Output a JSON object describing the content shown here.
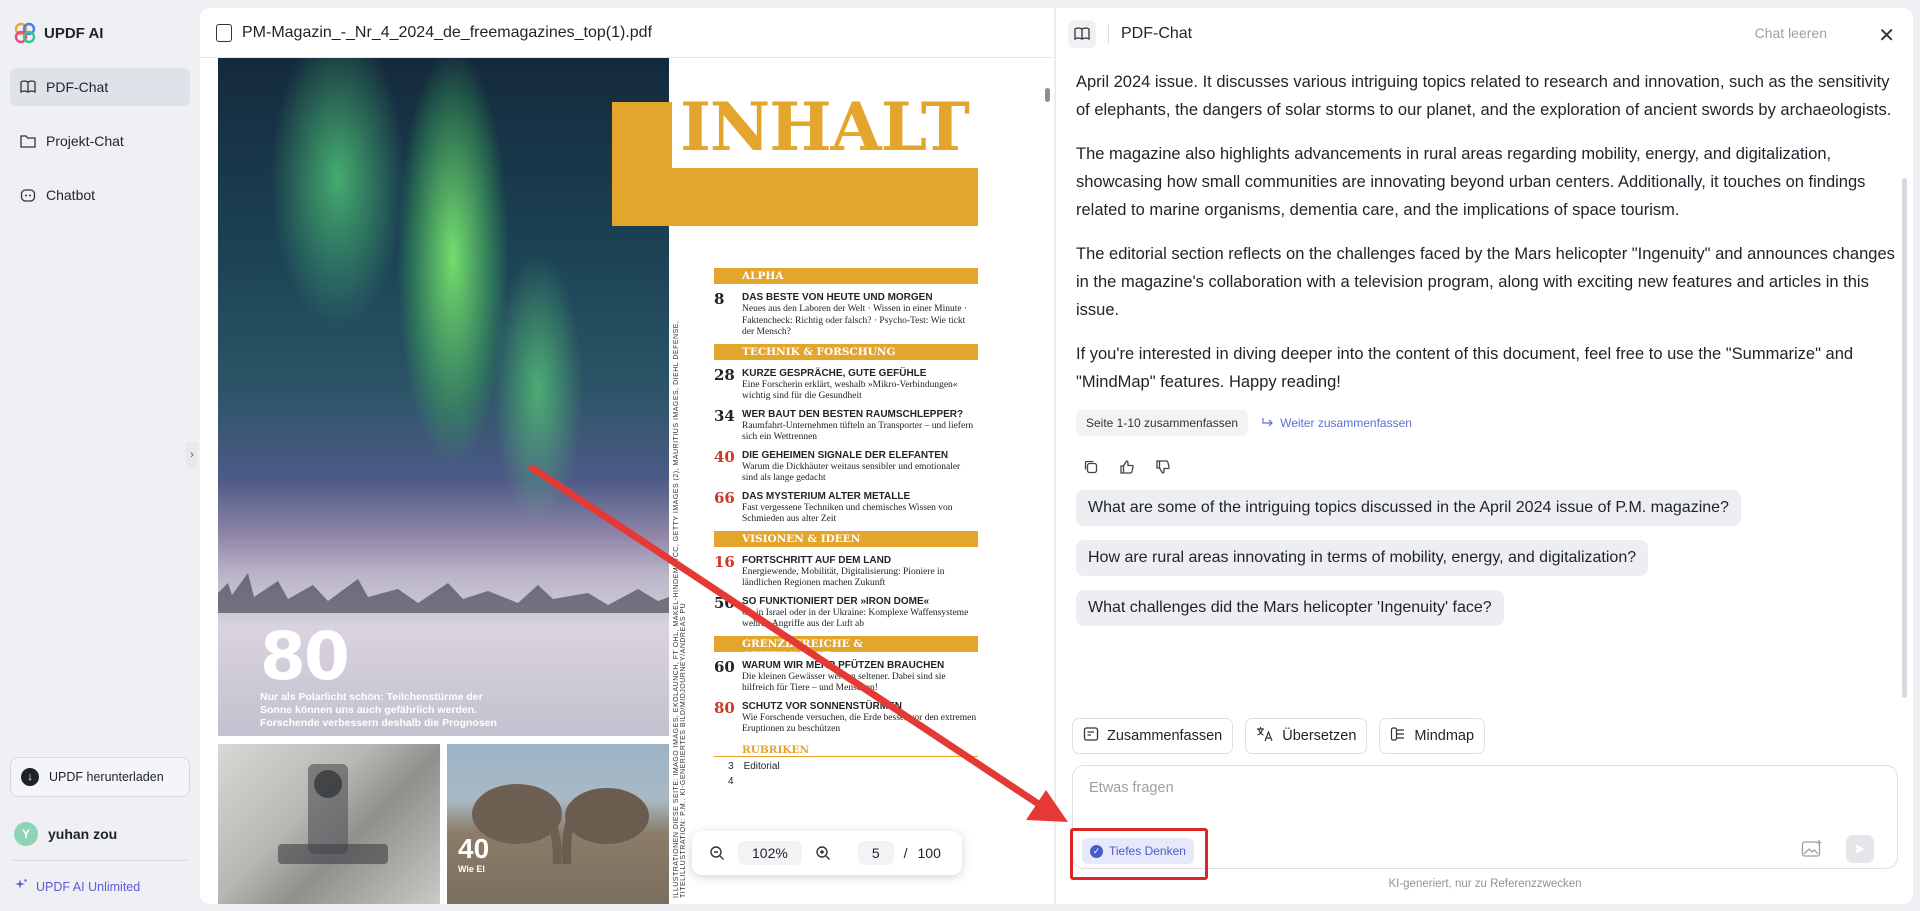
{
  "app": {
    "name": "UPDF AI"
  },
  "sidebar": {
    "items": [
      {
        "label": "PDF-Chat",
        "icon": "book-icon",
        "active": true
      },
      {
        "label": "Projekt-Chat",
        "icon": "folder-icon",
        "active": false
      },
      {
        "label": "Chatbot",
        "icon": "bot-icon",
        "active": false
      }
    ],
    "download_label": "UPDF herunterladen",
    "user": {
      "initial": "Y",
      "name": "yuhan zou"
    },
    "plan_label": "UPDF AI Unlimited"
  },
  "pdf": {
    "file_name": "PM-Magazin_-_Nr_4_2024_de_freemagazines_top(1).pdf",
    "zoom": "102%",
    "current_page": "5",
    "page_separator": "/",
    "total_pages": "100",
    "content": {
      "title": "INHALT",
      "cover_number": "80",
      "cover_caption": "Nur als Polarlicht schön: Teilchenstürme der Sonne können uns auch gefährlich werden. Forschende verbessern deshalb die Prognosen",
      "photo_number": "40",
      "photo_caption": "Wie El",
      "spine": "ILLUSTRATIONEN DIESE SEITE: IMAGO IMAGES, EKOLAUNCH, FT OHL, MAKEL-HINDEMIT/CC, GETTY IMAGES (2), MAURITIUS IMAGES, DIEHL DEFENSE, TITELILLUSTRATION: P.M., KI-GENERIERTES BILD/MIDJOURNEY/ANDREAS PU",
      "sections": [
        {
          "head": "ALPHA",
          "entries": [
            {
              "num": "8",
              "red": false,
              "title": "DAS BESTE VON HEUTE UND MORGEN",
              "desc": "Neues aus den Laboren der Welt · Wissen in einer Minute · Faktencheck: Richtig oder falsch? · Psycho-Test: Wie tickt der Mensch?"
            }
          ]
        },
        {
          "head": "TECHNIK & FORSCHUNG",
          "entries": [
            {
              "num": "28",
              "red": false,
              "title": "KURZE GESPRÄCHE, GUTE GEFÜHLE",
              "desc": "Eine Forscherin erklärt, weshalb »Mikro-Verbindungen« wichtig sind für die Gesundheit"
            },
            {
              "num": "34",
              "red": false,
              "title": "WER BAUT DEN BESTEN RAUMSCHLEPPER?",
              "desc": "Raumfahrt-Unternehmen tüfteln an Transporter – und liefern sich ein Wettrennen"
            },
            {
              "num": "40",
              "red": true,
              "title": "DIE GEHEIMEN SIGNALE DER ELEFANTEN",
              "desc": "Warum die Dickhäuter weitaus sensibler und emotionaler sind als lange gedacht"
            },
            {
              "num": "66",
              "red": true,
              "title": "DAS MYSTERIUM ALTER METALLE",
              "desc": "Fast vergessene Techniken und chemisches Wissen von Schmieden aus alter Zeit"
            }
          ]
        },
        {
          "head": "VISIONEN & IDEEN",
          "entries": [
            {
              "num": "16",
              "red": true,
              "title": "FORTSCHRITT AUF DEM LAND",
              "desc": "Energiewende, Mobilität, Digitalisierung: Pioniere in ländlichen Regionen machen Zukunft"
            },
            {
              "num": "50",
              "red": false,
              "title": "SO FUNKTIONIERT DER »IRON DOME«",
              "desc": "Ob in Israel oder in der Ukraine: Komplexe Waffensysteme wehren Angriffe aus der Luft ab"
            }
          ]
        },
        {
          "head": "GRENZBEREICHE & GEHEIMNISSE",
          "entries": [
            {
              "num": "60",
              "red": false,
              "title": "WARUM WIR MEHR PFÜTZEN BRAUCHEN",
              "desc": "Die kleinen Gewässer werden seltener. Dabei sind sie hilfreich für Tiere – und Menschen!"
            },
            {
              "num": "80",
              "red": true,
              "title": "SCHUTZ VOR SONNENSTÜRMEN",
              "desc": "Wie Forschende versuchen, die Erde besser vor den extremen Eruptionen zu beschützen"
            }
          ]
        }
      ],
      "rubriken_head": "RUBRIKEN",
      "rubriken": [
        {
          "num": "3",
          "label": "Editorial"
        },
        {
          "num": "4",
          "label": ""
        }
      ]
    }
  },
  "chat": {
    "title": "PDF-Chat",
    "clear_label": "Chat leeren",
    "paragraphs": [
      "April 2024 issue. It discusses various intriguing topics related to research and innovation, such as the sensitivity of elephants, the dangers of solar storms to our planet, and the exploration of ancient swords by archaeologists.",
      "The magazine also highlights advancements in rural areas regarding mobility, energy, and digitalization, showcasing how small communities are innovating beyond urban centers. Additionally, it touches on findings related to marine organisms, dementia care, and the implications of space tourism.",
      "The editorial section reflects on the challenges faced by the Mars helicopter \"Ingenuity\" and announces changes in the magazine's collaboration with a television program, along with exciting new features and articles in this issue.",
      "If you're interested in diving deeper into the content of this document, feel free to use the \"Summarize\" and \"MindMap\" features. Happy reading!"
    ],
    "summary_chip": "Seite 1-10 zusammenfassen",
    "continue_summary": "Weiter zusammenfassen",
    "suggestions": [
      "What are some of the intriguing topics discussed in the April 2024 issue of P.M. magazine?",
      "How are rural areas innovating in terms of mobility, energy, and digitalization?",
      "What challenges did the Mars helicopter 'Ingenuity' face?"
    ],
    "tools": [
      {
        "label": "Zusammenfassen",
        "icon": "summarize-icon"
      },
      {
        "label": "Übersetzen",
        "icon": "translate-icon"
      },
      {
        "label": "Mindmap",
        "icon": "mindmap-icon"
      }
    ],
    "input_placeholder": "Etwas fragen",
    "deep_thinking_label": "Tiefes Denken",
    "footer_note": "KI-generiert, nur zu Referenzzwecken"
  },
  "colors": {
    "accent": "#4a5bd0",
    "magazine_orange": "#e3a52c",
    "annotation_red": "#e02424"
  }
}
